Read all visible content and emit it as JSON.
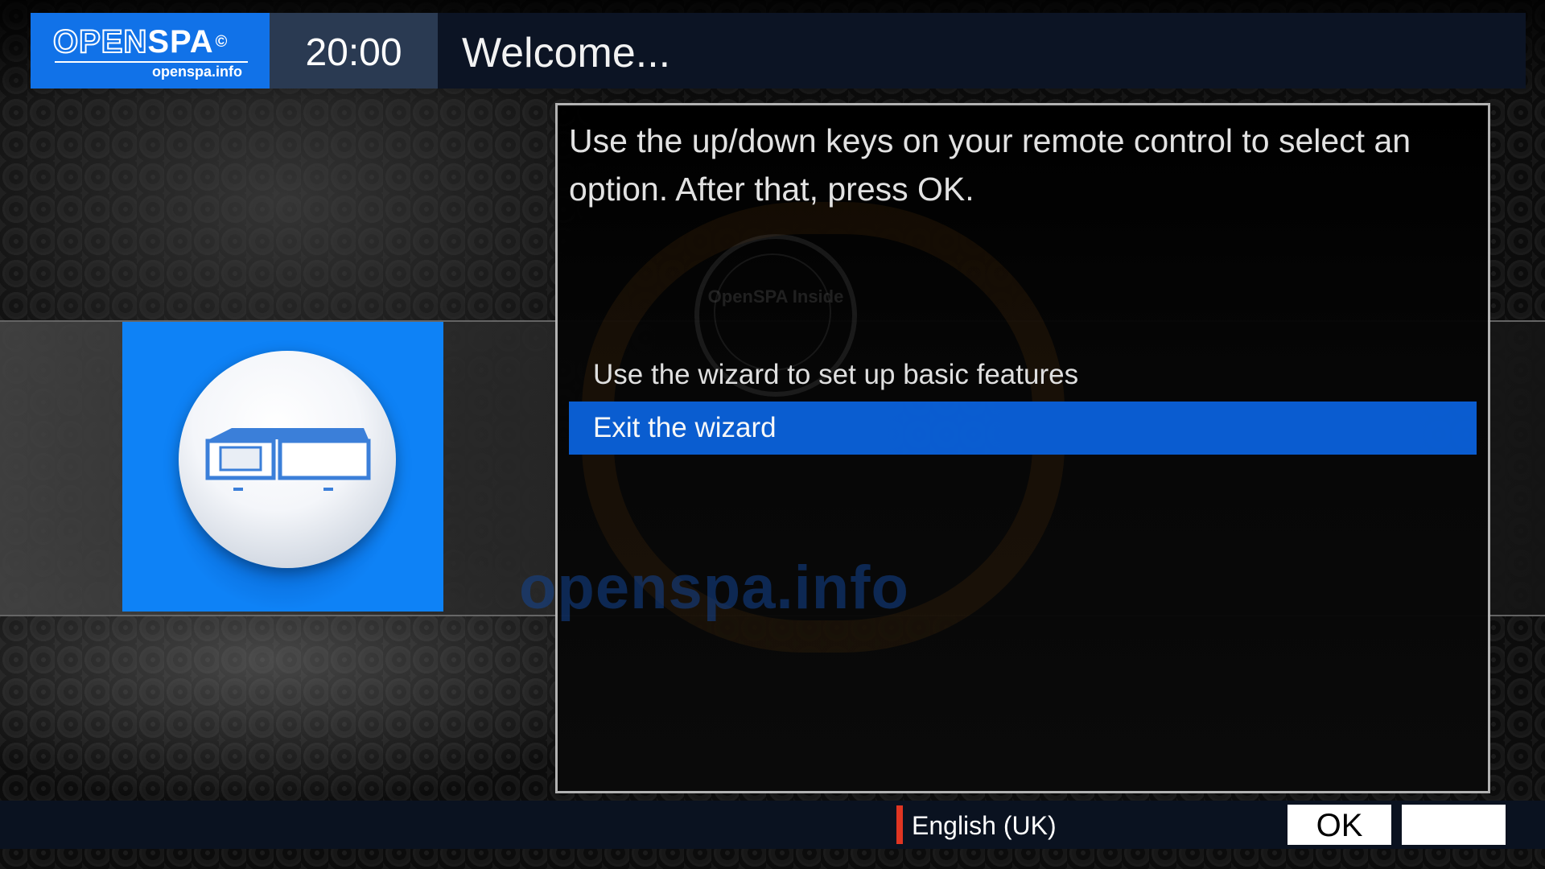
{
  "header": {
    "logo_text": "OPENSPA",
    "logo_url_text": "openspa.info",
    "clock": "20:00",
    "title": "Welcome..."
  },
  "dialog": {
    "instruction": "Use the up/down keys on your remote control to select an option. After that, press OK.",
    "watermark_seal_text": "OpenSPA Inside",
    "watermark_url": "openspa.info",
    "menu": [
      {
        "label": "Use the wizard to set up basic features",
        "selected": false
      },
      {
        "label": "Exit the wizard",
        "selected": true
      }
    ]
  },
  "footer": {
    "language": "English (UK)",
    "ok_label": "OK",
    "blank_label": ""
  },
  "colors": {
    "accent_blue": "#1172e8",
    "selection_blue": "#0a5fd6",
    "red_key": "#e03522",
    "header_bg": "#0c1424"
  },
  "icons": {
    "wizard_icon": "wizard-icon"
  }
}
